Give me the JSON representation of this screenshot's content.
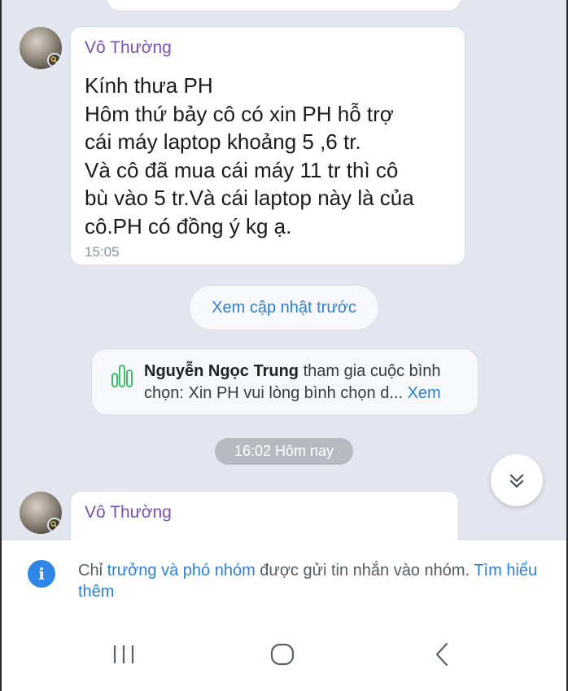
{
  "messages": [
    {
      "sender": "Vô Thường",
      "text": "Kính thưa PH\nHôm thứ bảy cô có xin PH hỗ trợ\ncái máy laptop khoảng 5 ,6 tr.\nVà cô đã mua cái máy 11 tr thì cô\nbù vào 5 tr.Và cái laptop này là của\ncô.PH có đồng ý kg ạ.",
      "time": "15:05"
    },
    {
      "sender": "Vô Thường"
    }
  ],
  "load_previous_label": "Xem cập nhật trước",
  "poll_event": {
    "actor": "Nguyễn Ngọc Trung",
    "action": "tham gia cuộc bình chọn:",
    "poll_title": "Xin PH vui lòng bình chọn d...",
    "view_link": "Xem",
    "icon": "poll-chart-icon"
  },
  "date_separator": "16:02 Hôm nay",
  "scroll_button_icon": "chevron-double-down-icon",
  "notice": {
    "prefix": "Chỉ ",
    "role_link": "trưởng và phó nhóm",
    "middle": " được gửi tin nhắn vào nhóm. ",
    "learn_more": "Tìm hiểu thêm"
  },
  "navbar": {
    "icons": [
      "recent-apps-icon",
      "home-icon",
      "back-icon"
    ]
  },
  "colors": {
    "background": "#e3e6ee",
    "sender_name": "#7a4fb8",
    "link": "#2c7fd6",
    "info_icon": "#2f86e6"
  }
}
